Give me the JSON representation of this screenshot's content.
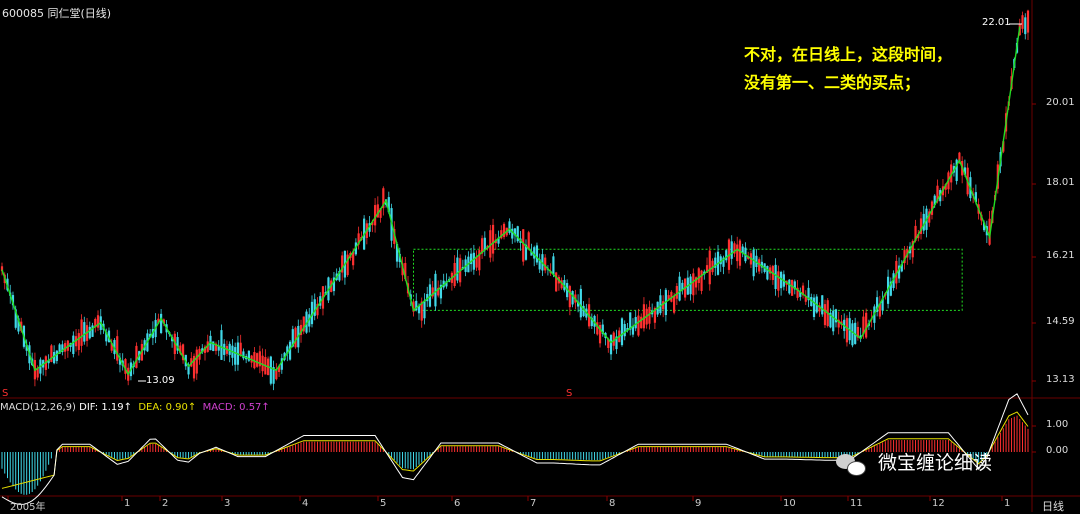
{
  "header": {
    "title": "600085 同仁堂(日线)"
  },
  "annotation": {
    "line1": "不对，在日线上，这段时间，",
    "line2": "没有第一、二类的买点；"
  },
  "watermark": {
    "text": "微宝缠论细读"
  },
  "macd_legend": {
    "name": "MACD(12,26,9)",
    "dif_label": "DIF:",
    "dif_value": "1.19↑",
    "dea_label": "DEA:",
    "dea_value": "0.90↑",
    "macd_label": "MACD:",
    "macd_value": "0.57↑"
  },
  "period_label": "日线",
  "markers": {
    "high": "22.01",
    "low": "13.09",
    "s1": "S",
    "s2": "S"
  },
  "colors": {
    "up": "#ff3030",
    "down": "#40d8e8",
    "stroke": "#22dd22",
    "box": "#22dd22",
    "dif": "#ffffff",
    "dea": "#e8e000",
    "macd": "#d040d0"
  },
  "chart_data": [
    {
      "type": "candlestick",
      "title": "600085 同仁堂(日线)",
      "y_ticks": [
        "13.13",
        "14.59",
        "16.21",
        "18.01",
        "20.01"
      ],
      "ylim": [
        13.0,
        22.5
      ],
      "x_ticks": [
        "2005年",
        "1",
        "2",
        "3",
        "4",
        "5",
        "6",
        "7",
        "8",
        "9",
        "10",
        "11",
        "12",
        "1"
      ],
      "bi_strokes": [
        {
          "i": 0,
          "price": 15.9
        },
        {
          "i": 12,
          "price": 13.4
        },
        {
          "i": 36,
          "price": 14.6
        },
        {
          "i": 46,
          "price": 13.3
        },
        {
          "i": 58,
          "price": 14.7
        },
        {
          "i": 68,
          "price": 13.5
        },
        {
          "i": 76,
          "price": 14.1
        },
        {
          "i": 100,
          "price": 13.4
        },
        {
          "i": 140,
          "price": 17.6
        },
        {
          "i": 150,
          "price": 14.9
        },
        {
          "i": 185,
          "price": 16.9
        },
        {
          "i": 205,
          "price": 15.5
        },
        {
          "i": 222,
          "price": 14.1
        },
        {
          "i": 268,
          "price": 16.4
        },
        {
          "i": 290,
          "price": 15.4
        },
        {
          "i": 313,
          "price": 14.2
        },
        {
          "i": 349,
          "price": 18.6
        },
        {
          "i": 360,
          "price": 16.7
        },
        {
          "i": 371,
          "price": 21.9
        }
      ],
      "zhongshu": {
        "start_i": 150,
        "end_i": 350,
        "low": 14.9,
        "high": 16.4
      },
      "annotations": [
        "22.01",
        "13.09"
      ]
    },
    {
      "type": "line",
      "title": "MACD(12,26,9)",
      "series": [
        {
          "name": "DIF",
          "last": 1.19
        },
        {
          "name": "DEA",
          "last": 0.9
        },
        {
          "name": "MACD",
          "last": 0.57
        }
      ],
      "y_ticks": [
        "1.00",
        "0.00"
      ]
    }
  ]
}
